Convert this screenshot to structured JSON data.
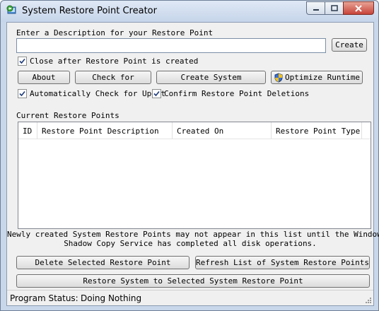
{
  "window": {
    "title": "System Restore Point Creator",
    "icon": "app-restore-icon",
    "controls": [
      "minimize-icon",
      "maximize-icon",
      "close-icon"
    ]
  },
  "description": {
    "label": "Enter a Description for your Restore Point",
    "value": "",
    "create_label": "Create"
  },
  "options": {
    "close_after": {
      "label": "Close after Restore Point is created",
      "checked": true
    },
    "auto_check": {
      "label": "Automatically Check for Updat",
      "checked": true
    },
    "confirm_delete": {
      "label": "Confirm Restore Point Deletions",
      "checked": true
    }
  },
  "buttons": {
    "about": "About",
    "check_for": "Check for",
    "create_system": "Create System",
    "optimize_runtime": "Optimize Runtime"
  },
  "restore_points": {
    "label": "Current Restore Points",
    "columns": [
      "ID",
      "Restore Point Description",
      "Created On",
      "Restore Point Type"
    ],
    "rows": []
  },
  "notice": {
    "line1": "Newly created System Restore Points may not appear in this list until the Windows",
    "line2": "Shadow Copy Service has completed all disk operations."
  },
  "actions": {
    "delete_selected": "Delete Selected Restore Point",
    "refresh_list": "Refresh List of System Restore Points",
    "restore_selected": "Restore System to Selected System Restore Point"
  },
  "status": {
    "label": "Program Status:",
    "value": "Doing Nothing"
  }
}
